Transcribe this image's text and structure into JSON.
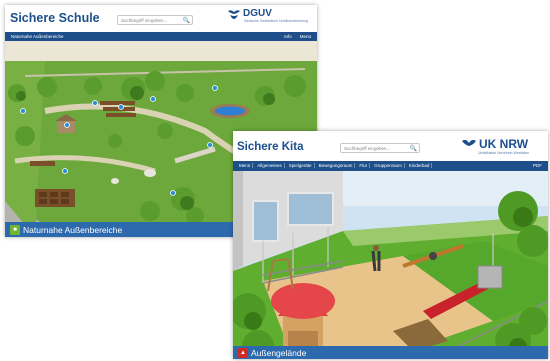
{
  "schule": {
    "brand": "Sichere Schule",
    "search_placeholder": "Suchbegriff eingeben...",
    "logo_text": "DGUV",
    "logo_sub": "Deutsche Gesetzliche Unfallversicherung",
    "nav_left": "Naturnahe Außenbereiche",
    "nav_right": [
      "Info",
      "Menü"
    ],
    "caption": "Naturnahe Außenbereiche",
    "caption_icon_color": "#6fb52e"
  },
  "kita": {
    "brand": "Sichere Kita",
    "search_placeholder": "Suchbegriff eingeben...",
    "logo_text": "UK NRW",
    "logo_sub": "Unfallkasse Nordrhein-Westfalen",
    "nav_items": [
      "Menü",
      "Allgemeines",
      "Spielgeräte",
      "Bewegungsraum",
      "Flur",
      "Gruppenraum",
      "Kinderbad"
    ],
    "nav_right": "PDF",
    "caption": "Außengelände",
    "caption_icon_color": "#d02a24"
  },
  "colors": {
    "nav": "#1e4f8a",
    "caption": "#2c69ad",
    "brand": "#1d4f8c"
  }
}
